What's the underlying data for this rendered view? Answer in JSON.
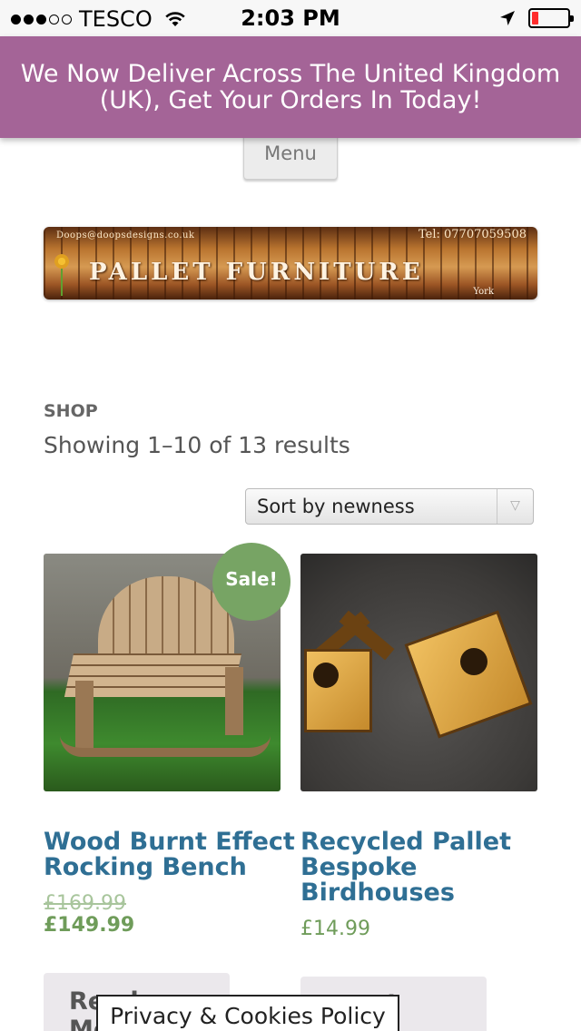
{
  "status_bar": {
    "carrier": "TESCO",
    "time": "2:03 PM",
    "signal_bars": 3,
    "signal_total": 5,
    "battery_level": 0.1,
    "battery_color": "#ff2d2d"
  },
  "banner": {
    "text": "We Now Deliver Across The United Kingdom (UK), Get Your Orders In Today!",
    "background": "#a46497"
  },
  "nav": {
    "menu_label": "Menu"
  },
  "logo": {
    "email": "Doops@doopsdesigns.co.uk",
    "tel": "Tel: 07707059508",
    "name": "Pallet Furniture",
    "location": "York"
  },
  "shop": {
    "title": "SHOP",
    "result_count": "Showing 1–10 of 13 results",
    "sort_selected": "Sort by newness"
  },
  "products": [
    {
      "title": "Wood Burnt Effect Rocking Bench",
      "badge": "Sale!",
      "price_old": "£169.99",
      "price_new": "£149.99",
      "button": "Read More",
      "image_icon": "rocking-bench-image"
    },
    {
      "title": "Recycled Pallet Bespoke Birdhouses",
      "price": "£14.99",
      "button": "Read More",
      "image_icon": "birdhouses-image"
    }
  ],
  "footer": {
    "privacy_label": "Privacy & Cookies Policy"
  },
  "colors": {
    "accent": "#a46497",
    "link": "#2f6f94",
    "price": "#6f9c5a",
    "sale_badge": "#77a464"
  }
}
